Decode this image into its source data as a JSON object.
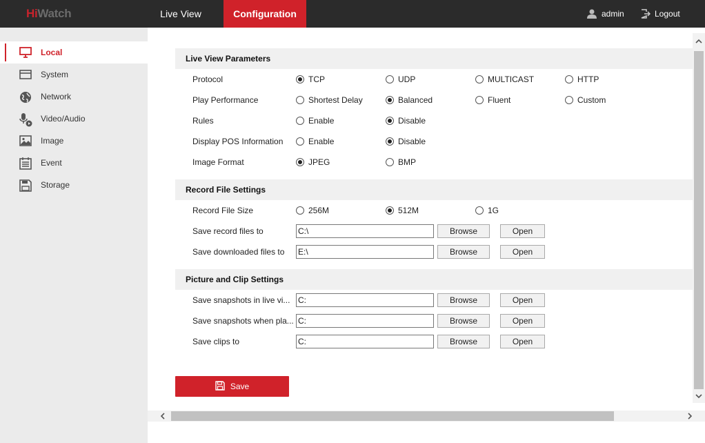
{
  "brand": {
    "hi": "Hi",
    "watch": "Watch"
  },
  "nav": {
    "live_view": "Live View",
    "configuration": "Configuration"
  },
  "user": {
    "name": "admin",
    "user_icon": "user-icon",
    "logout_label": "Logout",
    "logout_icon": "logout-icon"
  },
  "sidebar": {
    "items": [
      {
        "label": "Local",
        "icon": "monitor-icon",
        "active": true
      },
      {
        "label": "System",
        "icon": "window-icon",
        "active": false
      },
      {
        "label": "Network",
        "icon": "globe-icon",
        "active": false
      },
      {
        "label": "Video/Audio",
        "icon": "microphone-icon",
        "active": false
      },
      {
        "label": "Image",
        "icon": "image-icon",
        "active": false
      },
      {
        "label": "Event",
        "icon": "calendar-icon",
        "active": false
      },
      {
        "label": "Storage",
        "icon": "storage-icon",
        "active": false
      }
    ]
  },
  "live_view_params": {
    "title": "Live View Parameters",
    "protocol": {
      "label": "Protocol",
      "options": [
        "TCP",
        "UDP",
        "MULTICAST",
        "HTTP"
      ],
      "selected": "TCP"
    },
    "play_performance": {
      "label": "Play Performance",
      "options": [
        "Shortest Delay",
        "Balanced",
        "Fluent",
        "Custom"
      ],
      "selected": "Balanced"
    },
    "rules": {
      "label": "Rules",
      "options": [
        "Enable",
        "Disable"
      ],
      "selected": "Disable"
    },
    "display_pos": {
      "label": "Display POS Information",
      "options": [
        "Enable",
        "Disable"
      ],
      "selected": "Disable"
    },
    "image_format": {
      "label": "Image Format",
      "options": [
        "JPEG",
        "BMP"
      ],
      "selected": "JPEG"
    }
  },
  "record_file_settings": {
    "title": "Record File Settings",
    "file_size": {
      "label": "Record File Size",
      "options": [
        "256M",
        "512M",
        "1G"
      ],
      "selected": "512M"
    },
    "save_record": {
      "label": "Save record files to",
      "value": "C:\\"
    },
    "save_downloaded": {
      "label": "Save downloaded files to",
      "value": "E:\\"
    }
  },
  "picture_clip_settings": {
    "title": "Picture and Clip Settings",
    "snap_live": {
      "label": "Save snapshots in live vi...",
      "value": "C:"
    },
    "snap_playback": {
      "label": "Save snapshots when pla...",
      "value": "C:"
    },
    "clips": {
      "label": "Save clips to",
      "value": "C:"
    }
  },
  "buttons": {
    "browse": "Browse",
    "open": "Open",
    "save": "Save"
  },
  "colors": {
    "accent": "#d0222a",
    "topbar": "#2b2b2b",
    "sidebar": "#ebebeb"
  }
}
